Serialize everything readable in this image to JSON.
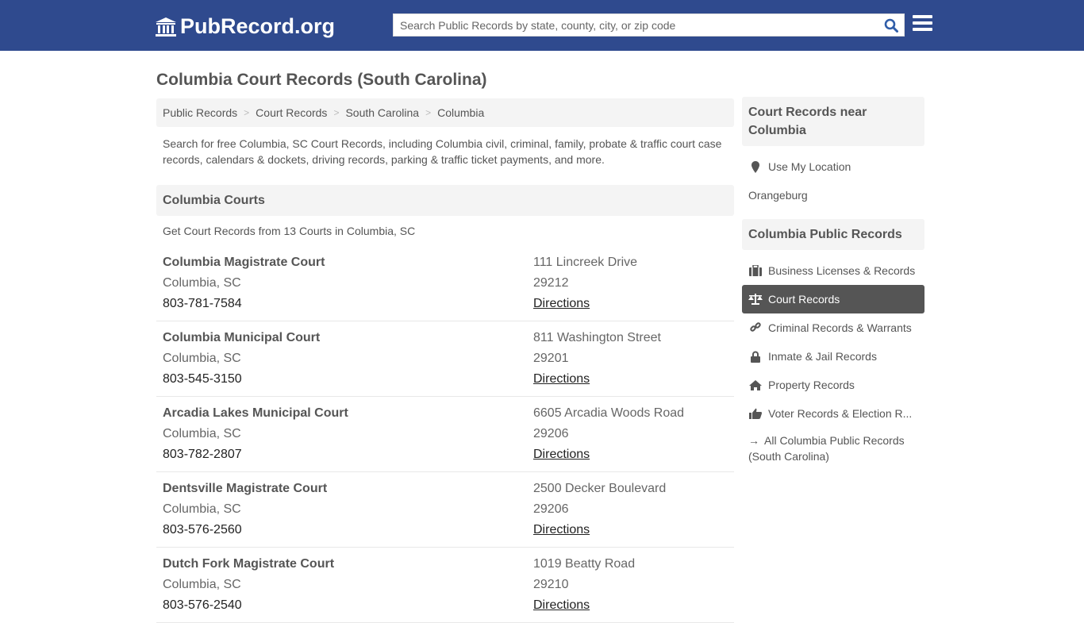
{
  "header": {
    "logo_text": "PubRecord.org",
    "search_placeholder": "Search Public Records by state, county, city, or zip code",
    "brand_color": "#2f4a8e"
  },
  "page_title": "Columbia Court Records (South Carolina)",
  "breadcrumb": [
    "Public Records",
    "Court Records",
    "South Carolina",
    "Columbia"
  ],
  "intro": "Search for free Columbia, SC Court Records, including Columbia civil, criminal, family, probate & traffic court case records, calendars & dockets, driving records, parking & traffic ticket payments, and more.",
  "courts_section": {
    "title": "Columbia Courts",
    "count_text": "Get Court Records from 13 Courts in Columbia, SC",
    "courts": [
      {
        "name": "Columbia Magistrate Court",
        "city": "Columbia, SC",
        "phone": "803-781-7584",
        "address": "111 Lincreek Drive",
        "zip": "29212",
        "directions": "Directions"
      },
      {
        "name": "Columbia Municipal Court",
        "city": "Columbia, SC",
        "phone": "803-545-3150",
        "address": "811 Washington Street",
        "zip": "29201",
        "directions": "Directions"
      },
      {
        "name": "Arcadia Lakes Municipal Court",
        "city": "Columbia, SC",
        "phone": "803-782-2807",
        "address": "6605 Arcadia Woods Road",
        "zip": "29206",
        "directions": "Directions"
      },
      {
        "name": "Dentsville Magistrate Court",
        "city": "Columbia, SC",
        "phone": "803-576-2560",
        "address": "2500 Decker Boulevard",
        "zip": "29206",
        "directions": "Directions"
      },
      {
        "name": "Dutch Fork Magistrate Court",
        "city": "Columbia, SC",
        "phone": "803-576-2540",
        "address": "1019 Beatty Road",
        "zip": "29210",
        "directions": "Directions"
      }
    ]
  },
  "sidebar": {
    "nearby_title": "Court Records near Columbia",
    "use_location": "Use My Location",
    "nearby": [
      "Orangeburg"
    ],
    "public_title": "Columbia Public Records",
    "items": [
      {
        "label": "Business Licenses & Records",
        "icon": "briefcase-icon",
        "active": false
      },
      {
        "label": "Court Records",
        "icon": "scale-icon",
        "active": true
      },
      {
        "label": "Criminal Records & Warrants",
        "icon": "link-icon",
        "active": false
      },
      {
        "label": "Inmate & Jail Records",
        "icon": "lock-icon",
        "active": false
      },
      {
        "label": "Property Records",
        "icon": "home-icon",
        "active": false
      },
      {
        "label": "Voter Records & Election R...",
        "icon": "thumbs-up-icon",
        "active": false
      }
    ],
    "all_records": "All Columbia Public Records (South Carolina)"
  }
}
